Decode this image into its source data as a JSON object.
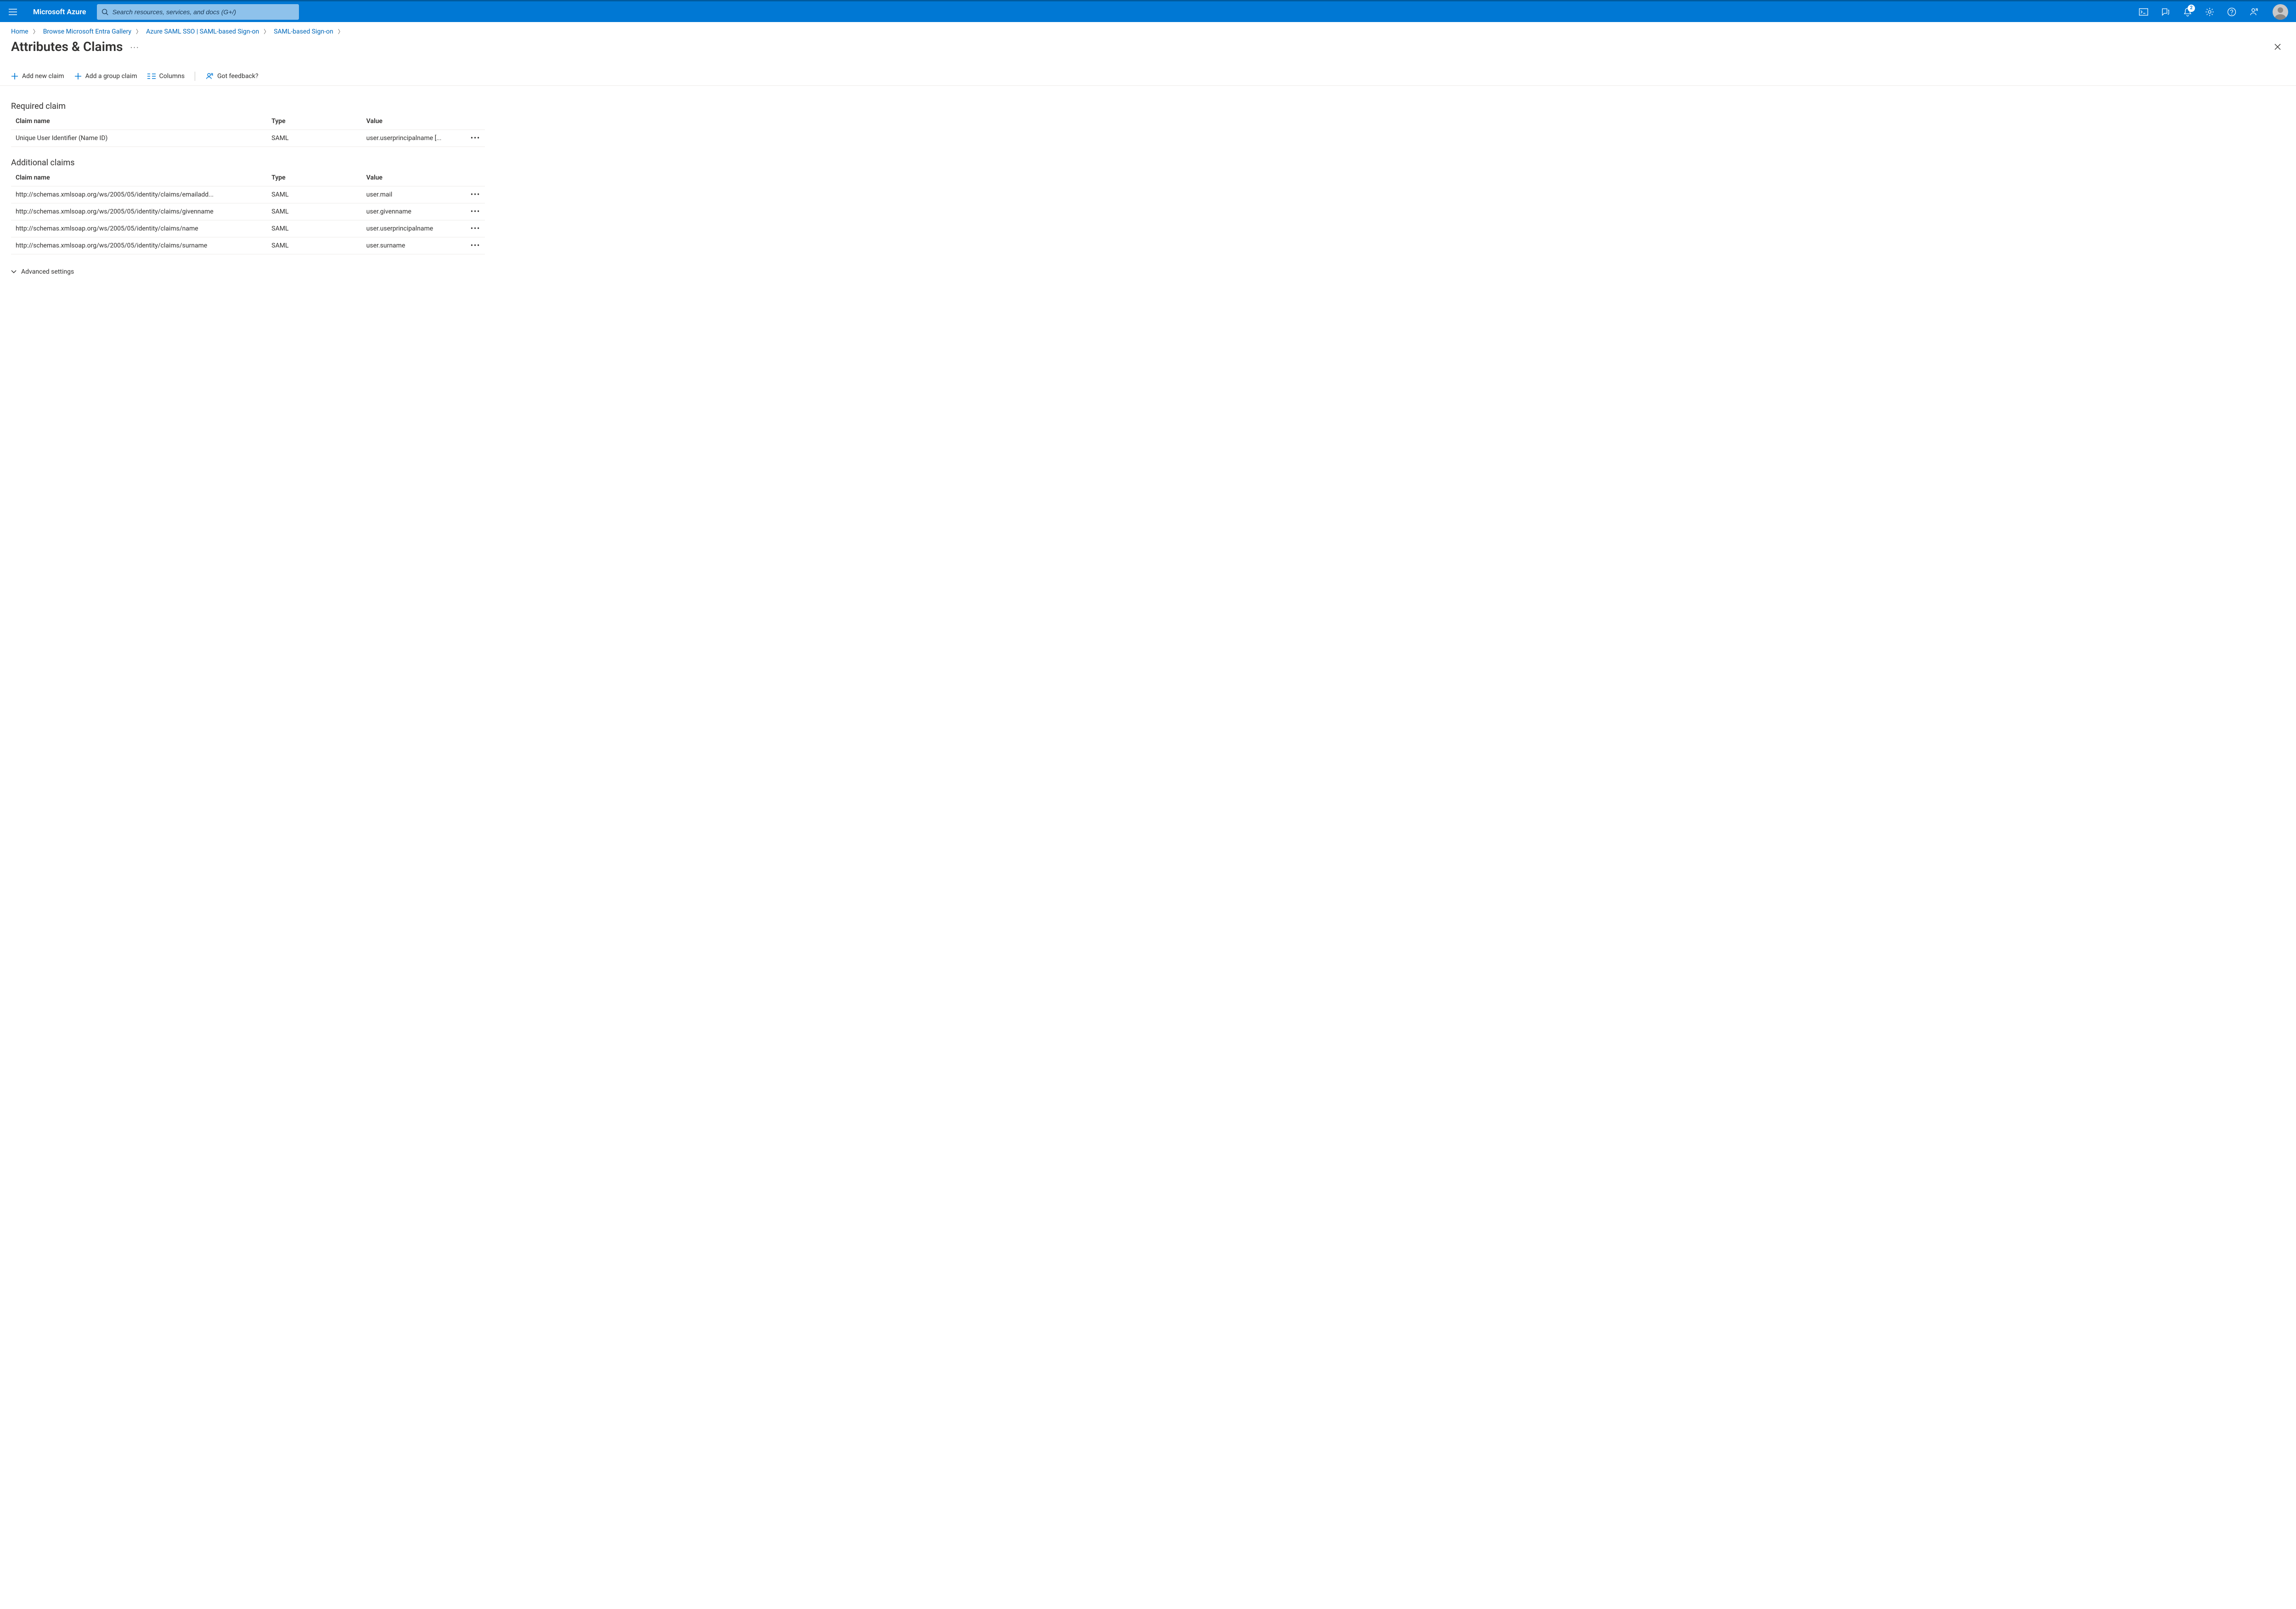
{
  "header": {
    "brand": "Microsoft Azure",
    "search_placeholder": "Search resources, services, and docs (G+/)",
    "notification_count": "2"
  },
  "breadcrumb": {
    "items": [
      {
        "label": "Home"
      },
      {
        "label": "Browse Microsoft Entra Gallery"
      },
      {
        "label": "Azure SAML SSO | SAML-based Sign-on"
      },
      {
        "label": "SAML-based Sign-on"
      }
    ]
  },
  "page": {
    "title": "Attributes & Claims"
  },
  "commands": {
    "add_new": "Add new claim",
    "add_group": "Add a group claim",
    "columns": "Columns",
    "feedback": "Got feedback?"
  },
  "required": {
    "title": "Required claim",
    "headers": {
      "name": "Claim name",
      "type": "Type",
      "value": "Value"
    },
    "rows": [
      {
        "name": "Unique User Identifier (Name ID)",
        "type": "SAML",
        "value": "user.userprincipalname [..."
      }
    ]
  },
  "additional": {
    "title": "Additional claims",
    "headers": {
      "name": "Claim name",
      "type": "Type",
      "value": "Value"
    },
    "rows": [
      {
        "name": "http://schemas.xmlsoap.org/ws/2005/05/identity/claims/emailadd...",
        "type": "SAML",
        "value": "user.mail"
      },
      {
        "name": "http://schemas.xmlsoap.org/ws/2005/05/identity/claims/givenname",
        "type": "SAML",
        "value": "user.givenname"
      },
      {
        "name": "http://schemas.xmlsoap.org/ws/2005/05/identity/claims/name",
        "type": "SAML",
        "value": "user.userprincipalname"
      },
      {
        "name": "http://schemas.xmlsoap.org/ws/2005/05/identity/claims/surname",
        "type": "SAML",
        "value": "user.surname"
      }
    ]
  },
  "advanced": {
    "label": "Advanced settings"
  }
}
